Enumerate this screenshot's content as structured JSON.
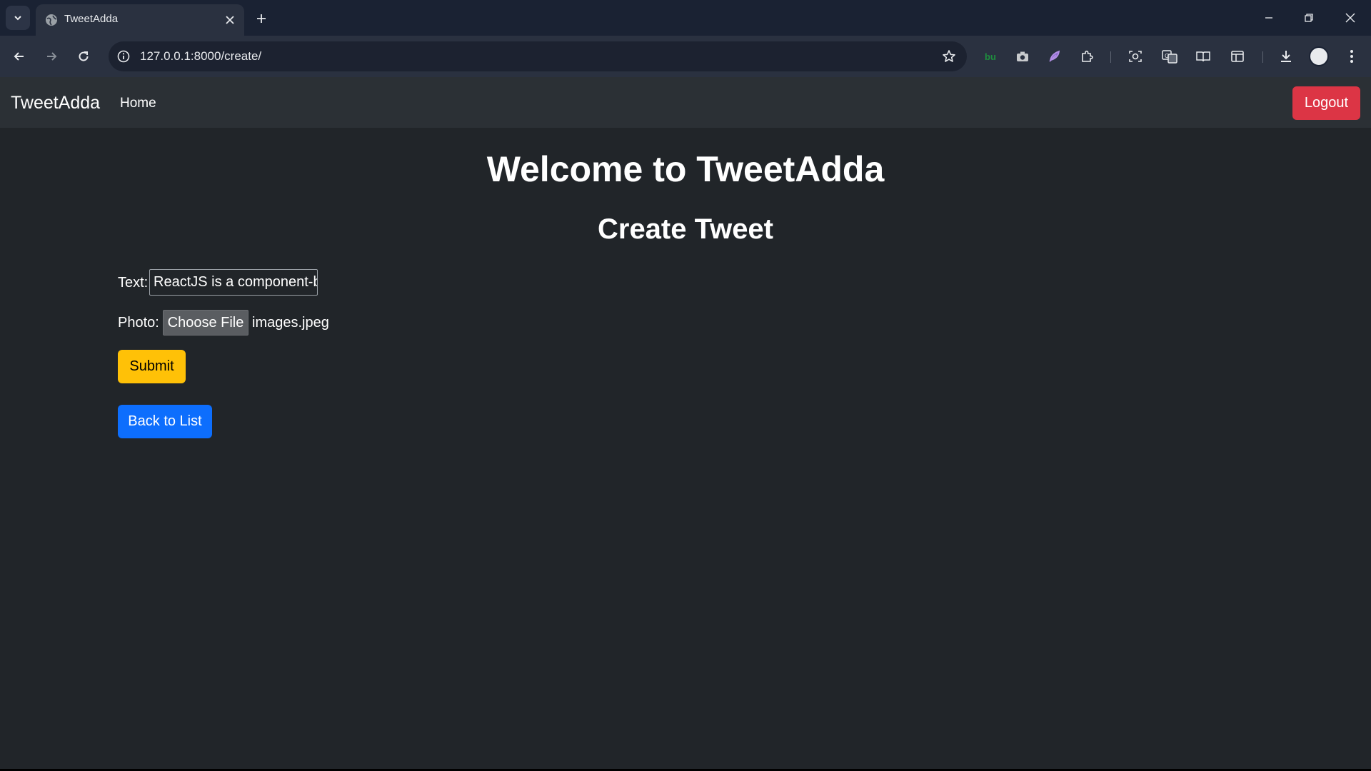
{
  "browser": {
    "tab_title": "TweetAdda",
    "url": "127.0.0.1:8000/create/",
    "extension_icons": [
      "bu-extension-icon",
      "camera-icon",
      "feather-icon",
      "puzzle-icon",
      "screenshot-icon",
      "translate-icon",
      "reading-mode-icon",
      "sidebar-icon",
      "download-icon",
      "profile-avatar"
    ],
    "ext_label": "bu"
  },
  "navbar": {
    "brand": "TweetAdda",
    "home": "Home",
    "logout": "Logout"
  },
  "page": {
    "heading": "Welcome to TweetAdda",
    "subheading": "Create Tweet"
  },
  "form": {
    "text_label": "Text:",
    "text_value": "ReactJS is a component-b",
    "photo_label": "Photo:",
    "choose_file": "Choose File",
    "file_name": "images.jpeg",
    "submit": "Submit",
    "back": "Back to List"
  },
  "colors": {
    "page_bg": "#212529",
    "navbar_bg": "#2b3035",
    "logout": "#dc3545",
    "submit": "#ffc107",
    "back": "#0d6efd"
  }
}
